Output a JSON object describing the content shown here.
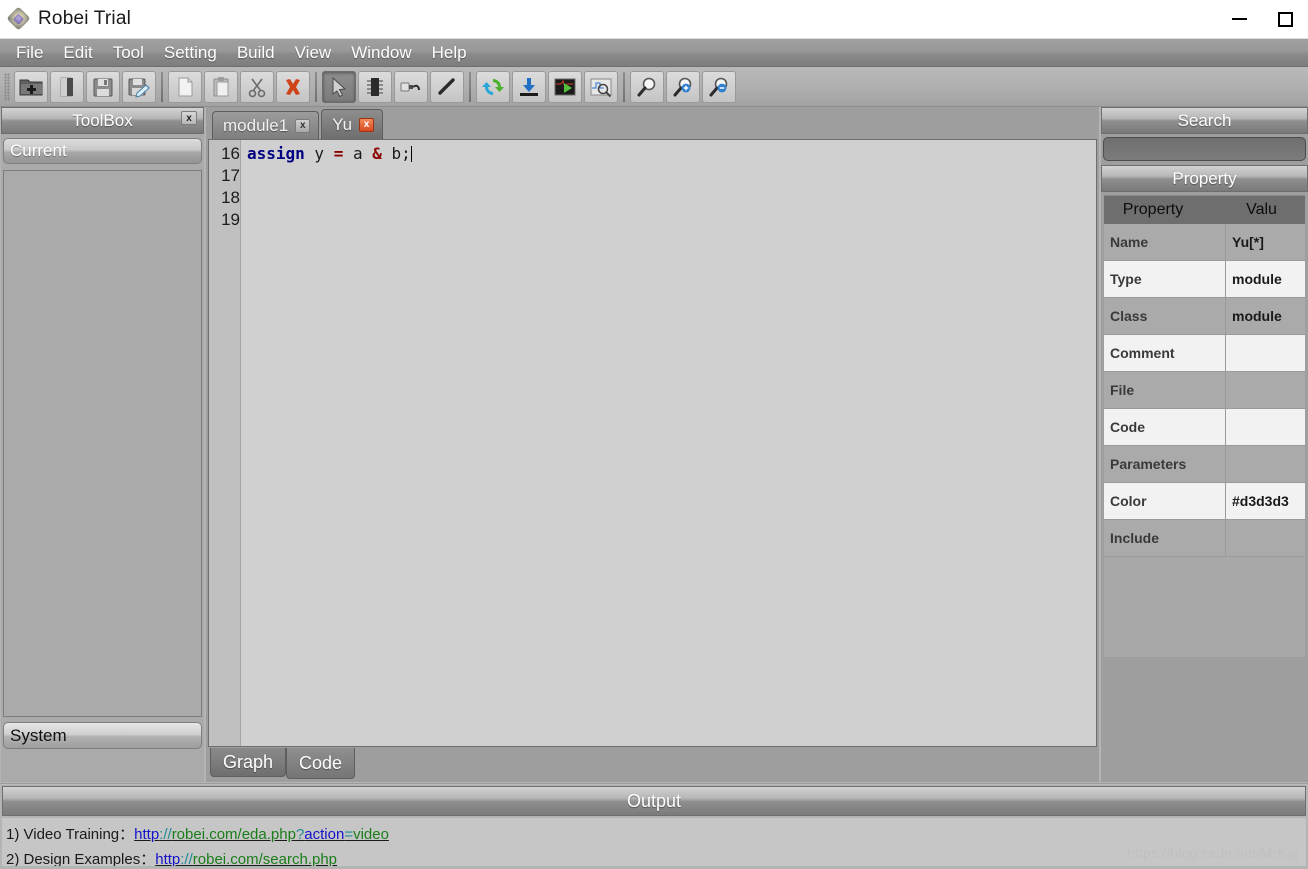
{
  "window": {
    "title": "Robei  Trial",
    "logo_icon": "robei-gem-logo",
    "minimize_label": "Minimize",
    "maximize_label": "Maximize"
  },
  "menubar": {
    "items": [
      {
        "label": "File"
      },
      {
        "label": "Edit"
      },
      {
        "label": "Tool"
      },
      {
        "label": "Setting"
      },
      {
        "label": "Build"
      },
      {
        "label": "View"
      },
      {
        "label": "Window"
      },
      {
        "label": "Help"
      }
    ]
  },
  "toolbar": {
    "groups": [
      [
        "new-project-icon",
        "open-project-icon",
        "save-icon",
        "save-as-icon"
      ],
      [
        "copy-icon",
        "paste-icon",
        "cut-icon",
        "delete-icon"
      ],
      [
        "pointer-select-icon",
        "module-chip-icon",
        "port-usb-icon",
        "wire-line-icon"
      ],
      [
        "compile-refresh-icon",
        "download-icon",
        "simulate-run-icon",
        "view-waveform-icon"
      ],
      [
        "zoom-fit-icon",
        "zoom-in-icon",
        "zoom-out-icon"
      ]
    ],
    "pressed": "pointer-select-icon"
  },
  "toolbox": {
    "title": "ToolBox",
    "close_label": "x",
    "current_label": "Current",
    "system_label": "System"
  },
  "editor": {
    "tabs": [
      {
        "label": "module1",
        "active": false,
        "close": "x"
      },
      {
        "label": "Yu",
        "active": true,
        "close": "x"
      }
    ],
    "gutter": [
      "16",
      "17",
      "18",
      "19"
    ],
    "code": {
      "line16": {
        "kw": "assign",
        "var_y": " y ",
        "eq": "=",
        "var_a": " a ",
        "amp": "&",
        "tail": " b;"
      }
    },
    "bottom_tabs": [
      {
        "label": "Graph",
        "active": false
      },
      {
        "label": "Code",
        "active": true
      }
    ]
  },
  "search": {
    "title": "Search",
    "value": "",
    "placeholder": ""
  },
  "property": {
    "title": "Property",
    "columns": [
      "Property",
      "Valu"
    ],
    "rows": [
      {
        "key": "Name",
        "value": "Yu[*]"
      },
      {
        "key": "Type",
        "value": "module"
      },
      {
        "key": "Class",
        "value": "module"
      },
      {
        "key": "Comment",
        "value": ""
      },
      {
        "key": "File",
        "value": ""
      },
      {
        "key": "Code",
        "value": ""
      },
      {
        "key": "Parameters",
        "value": ""
      },
      {
        "key": "Color",
        "value": "#d3d3d3"
      },
      {
        "key": "Include",
        "value": ""
      }
    ]
  },
  "output": {
    "title": "Output",
    "lines": [
      {
        "prefix": "1) Video Training：",
        "url_parts": [
          {
            "text": "http",
            "color": "blue"
          },
          {
            "text": "://",
            "color": "teal"
          },
          {
            "text": "robei.com/eda.php",
            "color": "green"
          },
          {
            "text": "?",
            "color": "teal"
          },
          {
            "text": "action",
            "color": "blue"
          },
          {
            "text": "=",
            "color": "teal"
          },
          {
            "text": "video",
            "color": "green"
          }
        ]
      },
      {
        "prefix": "2) Design Examples：",
        "url_parts": [
          {
            "text": "http",
            "color": "blue"
          },
          {
            "text": "://",
            "color": "teal"
          },
          {
            "text": "robei.com/search.php",
            "color": "green"
          }
        ]
      }
    ],
    "watermark": "https://blog.csdn.net/MrKaj"
  },
  "colors": {
    "accent_panel": "#7a7a7a",
    "editor_bg": "#d0d0d0",
    "keyword": "#000080",
    "operator": "#8b0000"
  }
}
